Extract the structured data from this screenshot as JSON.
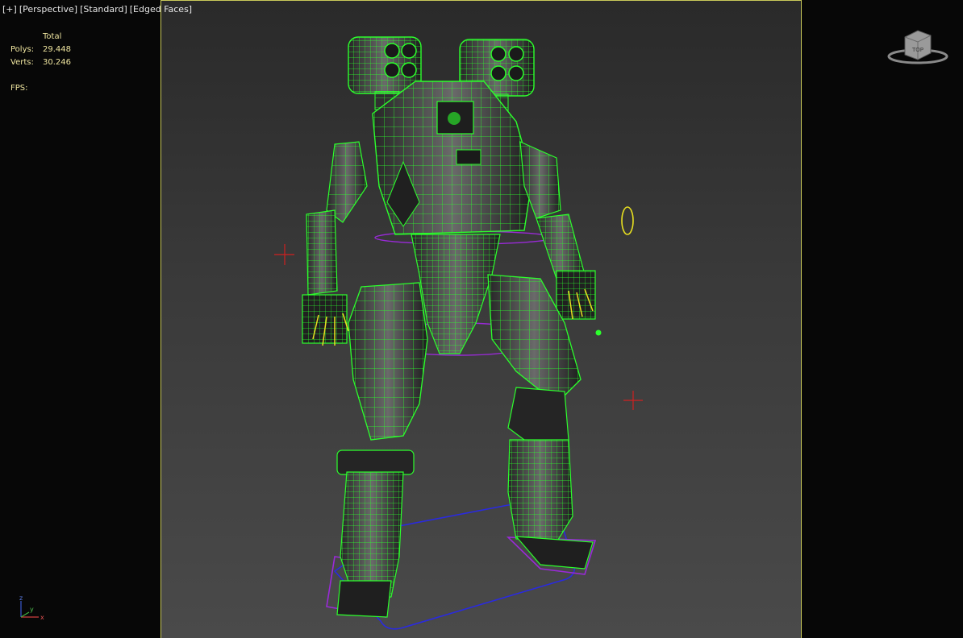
{
  "viewport": {
    "menu": {
      "plus_label": "[+]",
      "view_label": "[Perspective]",
      "shading_label": "[Standard]",
      "mode_label": "[Edged Faces]"
    },
    "stats": {
      "header": "Total",
      "polys_label": "Polys:",
      "polys_value": "29.448",
      "verts_label": "Verts:",
      "verts_value": "30.246",
      "fps_label": "FPS:",
      "fps_value": ""
    },
    "viewcube_face": "TOP",
    "axes": {
      "x": "x",
      "y": "y",
      "z": "z"
    }
  },
  "colors": {
    "background": "#070707",
    "wireframe": "#2cff2c",
    "mesh_fill": "#2f2f2f",
    "safe_frame": "#c9c95a",
    "stats_text": "#f0e6a0",
    "helper_red": "#d02020",
    "helper_purple": "#9a2ad8",
    "helper_blue": "#2a2ae0",
    "helper_yellow": "#e8e020"
  }
}
